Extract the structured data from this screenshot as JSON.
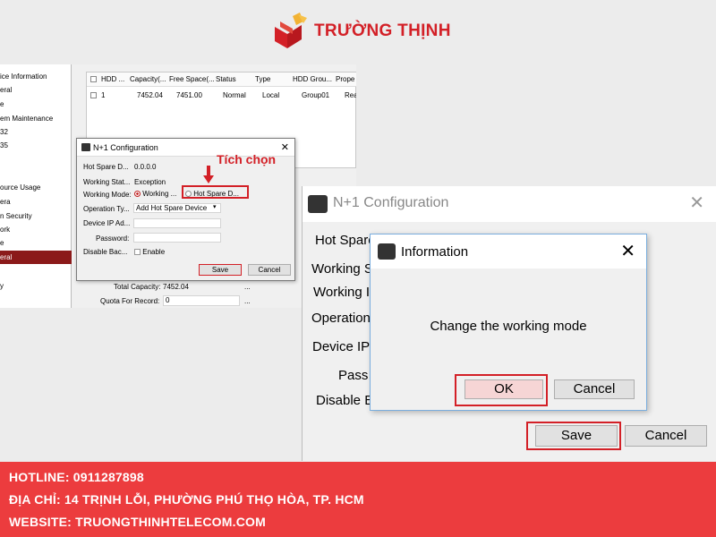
{
  "logo": {
    "text": "TRƯỜNG THỊNH",
    "colors": {
      "red": "#d32027",
      "gold": "#f2b233"
    }
  },
  "small_screenshot": {
    "sidebar": {
      "items": [
        "ice Information",
        "eral",
        "e",
        "em Maintenance",
        "32",
        "35",
        "",
        "ource Usage",
        "era",
        "n Security",
        "ork",
        "e",
        "eral",
        "",
        "y"
      ],
      "selected_index": 12
    },
    "hdd_table": {
      "columns": [
        "HDD ...",
        "Capacity(...",
        "Free Space(...",
        "Status",
        "Type",
        "HDD Grou...",
        "Prope"
      ],
      "rows": [
        [
          "1",
          "7452.04",
          "7451.00",
          "Normal",
          "Local",
          "Group01",
          "Read/"
        ]
      ]
    },
    "lower_fields": {
      "total_capacity_label": "Total Capacity:",
      "total_capacity_value": "7452.04",
      "total_capacity_unit": "...",
      "quota_label": "Quota For Record:",
      "quota_value": "0",
      "quota_unit": "..."
    },
    "dialog": {
      "title": "N+1 Configuration",
      "hot_spare_label": "Hot Spare D...",
      "hot_spare_value": "0.0.0.0",
      "working_status_label": "Working Stat...",
      "working_status_value": "Exception",
      "working_mode_label": "Working Mode:",
      "working_option": "Working ...",
      "hot_spare_option": "Hot Spare D...",
      "operation_type_label": "Operation Ty...",
      "operation_type_value": "Add Hot Spare Device",
      "device_ip_label": "Device IP Ad...",
      "password_label": "Password:",
      "disable_backup_label": "Disable Bac...",
      "enable_label": "Enable",
      "save_label": "Save",
      "cancel_label": "Cancel"
    }
  },
  "annotation": {
    "text": "Tích chọn"
  },
  "large_screenshot": {
    "title": "N+1 Configuration",
    "labels": [
      "Hot Spare",
      "Working S",
      "Working I",
      "Operation",
      "Device IP",
      "Pass",
      "Disable E"
    ],
    "save_label": "Save",
    "cancel_label": "Cancel",
    "info_dialog": {
      "title": "Information",
      "message": "Change the working mode",
      "ok_label": "OK",
      "cancel_label": "Cancel"
    }
  },
  "footer": {
    "hotline": "HOTLINE: 0911287898",
    "address": "ĐỊA CHỈ: 14 TRỊNH LỖI, PHƯỜNG PHÚ THỌ HÒA, TP. HCM",
    "website": "WEBSITE: TRUONGTHINHTELECOM.COM"
  }
}
